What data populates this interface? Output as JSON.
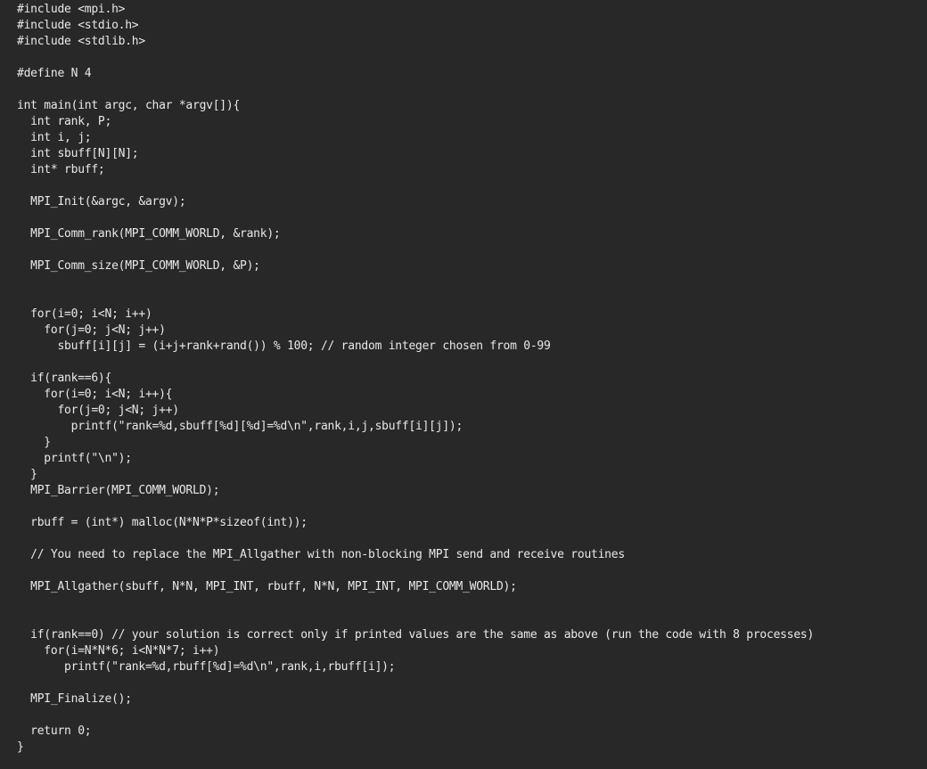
{
  "editor": {
    "background_color": "#282828",
    "text_color": "#e8e8e8",
    "language": "C",
    "lines": [
      "#include <mpi.h>",
      "#include <stdio.h>",
      "#include <stdlib.h>",
      "",
      "#define N 4",
      "",
      "int main(int argc, char *argv[]){",
      "  int rank, P;",
      "  int i, j;",
      "  int sbuff[N][N];",
      "  int* rbuff;",
      "",
      "  MPI_Init(&argc, &argv);",
      "",
      "  MPI_Comm_rank(MPI_COMM_WORLD, &rank);",
      "",
      "  MPI_Comm_size(MPI_COMM_WORLD, &P);",
      "",
      "",
      "  for(i=0; i<N; i++)",
      "    for(j=0; j<N; j++)",
      "      sbuff[i][j] = (i+j+rank+rand()) % 100; // random integer chosen from 0-99",
      "",
      "  if(rank==6){",
      "    for(i=0; i<N; i++){",
      "      for(j=0; j<N; j++)",
      "        printf(\"rank=%d,sbuff[%d][%d]=%d\\n\",rank,i,j,sbuff[i][j]);",
      "    }",
      "    printf(\"\\n\");",
      "  }",
      "  MPI_Barrier(MPI_COMM_WORLD);",
      "",
      "  rbuff = (int*) malloc(N*N*P*sizeof(int));",
      "",
      "  // You need to replace the MPI_Allgather with non-blocking MPI send and receive routines",
      "",
      "  MPI_Allgather(sbuff, N*N, MPI_INT, rbuff, N*N, MPI_INT, MPI_COMM_WORLD);",
      "",
      "",
      "  if(rank==0) // your solution is correct only if printed values are the same as above (run the code with 8 processes)",
      "    for(i=N*N*6; i<N*N*7; i++)",
      "       printf(\"rank=%d,rbuff[%d]=%d\\n\",rank,i,rbuff[i]);",
      "",
      "  MPI_Finalize();",
      "",
      "  return 0;",
      "}"
    ]
  }
}
